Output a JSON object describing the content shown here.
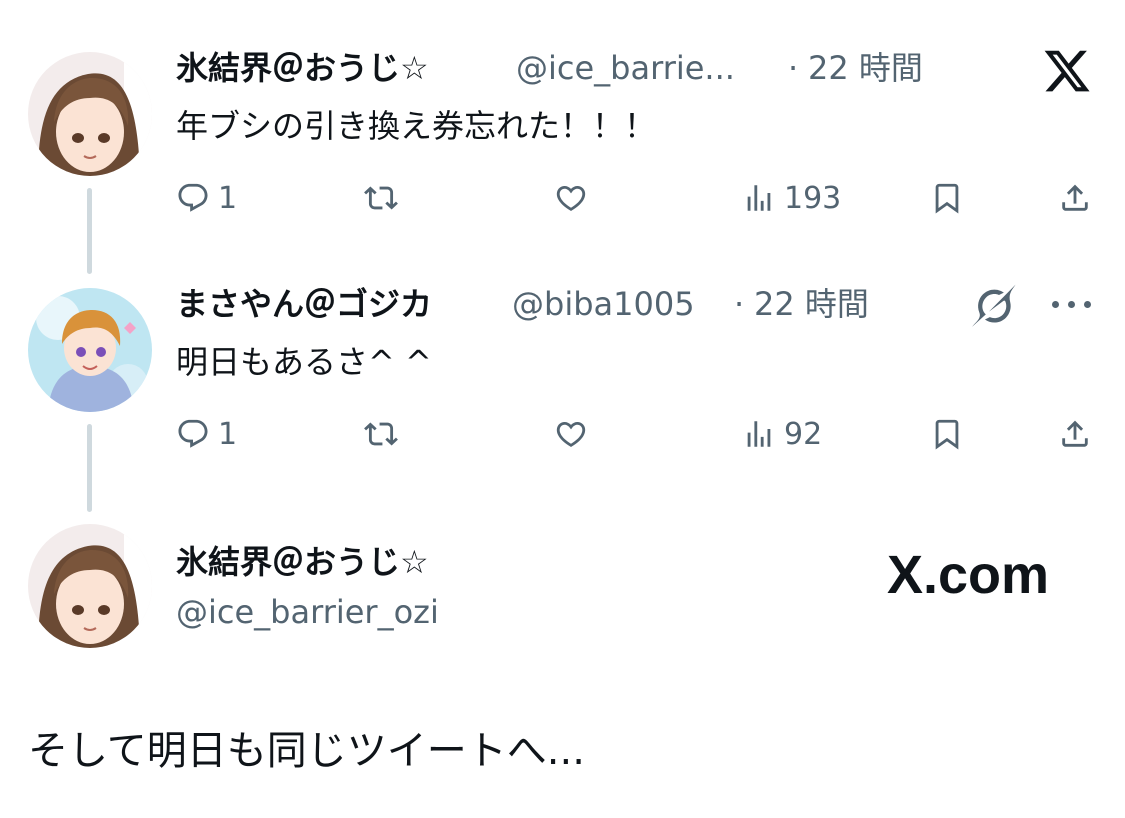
{
  "tweets": [
    {
      "author": "氷結界＠おうじ☆",
      "handle": "@ice_barrie...",
      "separator": "·",
      "time": "22 時間",
      "text": "年ブシの引き換え券忘れた！！！",
      "actions": {
        "reply": "1",
        "retweet": "",
        "like": "",
        "views": "193"
      }
    },
    {
      "author": "まさやん＠ゴジカ",
      "handle": "@biba1005",
      "separator": "·",
      "time": "22 時間",
      "text": "明日もあるさ^ ^",
      "actions": {
        "reply": "1",
        "retweet": "",
        "like": "",
        "views": "92"
      }
    }
  ],
  "profile_card": {
    "name": "氷結界＠おうじ☆",
    "handle": "@ice_barrier_ozi"
  },
  "brand": {
    "domain_text": "X.com"
  },
  "caption": "そして明日も同じツイートへ...",
  "icons": {
    "logo": "x-logo",
    "reply": "reply-icon",
    "retweet": "retweet-icon",
    "like": "heart-icon",
    "views": "views-icon",
    "bookmark": "bookmark-icon",
    "share": "share-icon",
    "grok": "grok-icon",
    "more": "more-icon"
  },
  "colors": {
    "text": "#0f1419",
    "secondary": "#536471",
    "thread_line": "#cfd9de"
  }
}
